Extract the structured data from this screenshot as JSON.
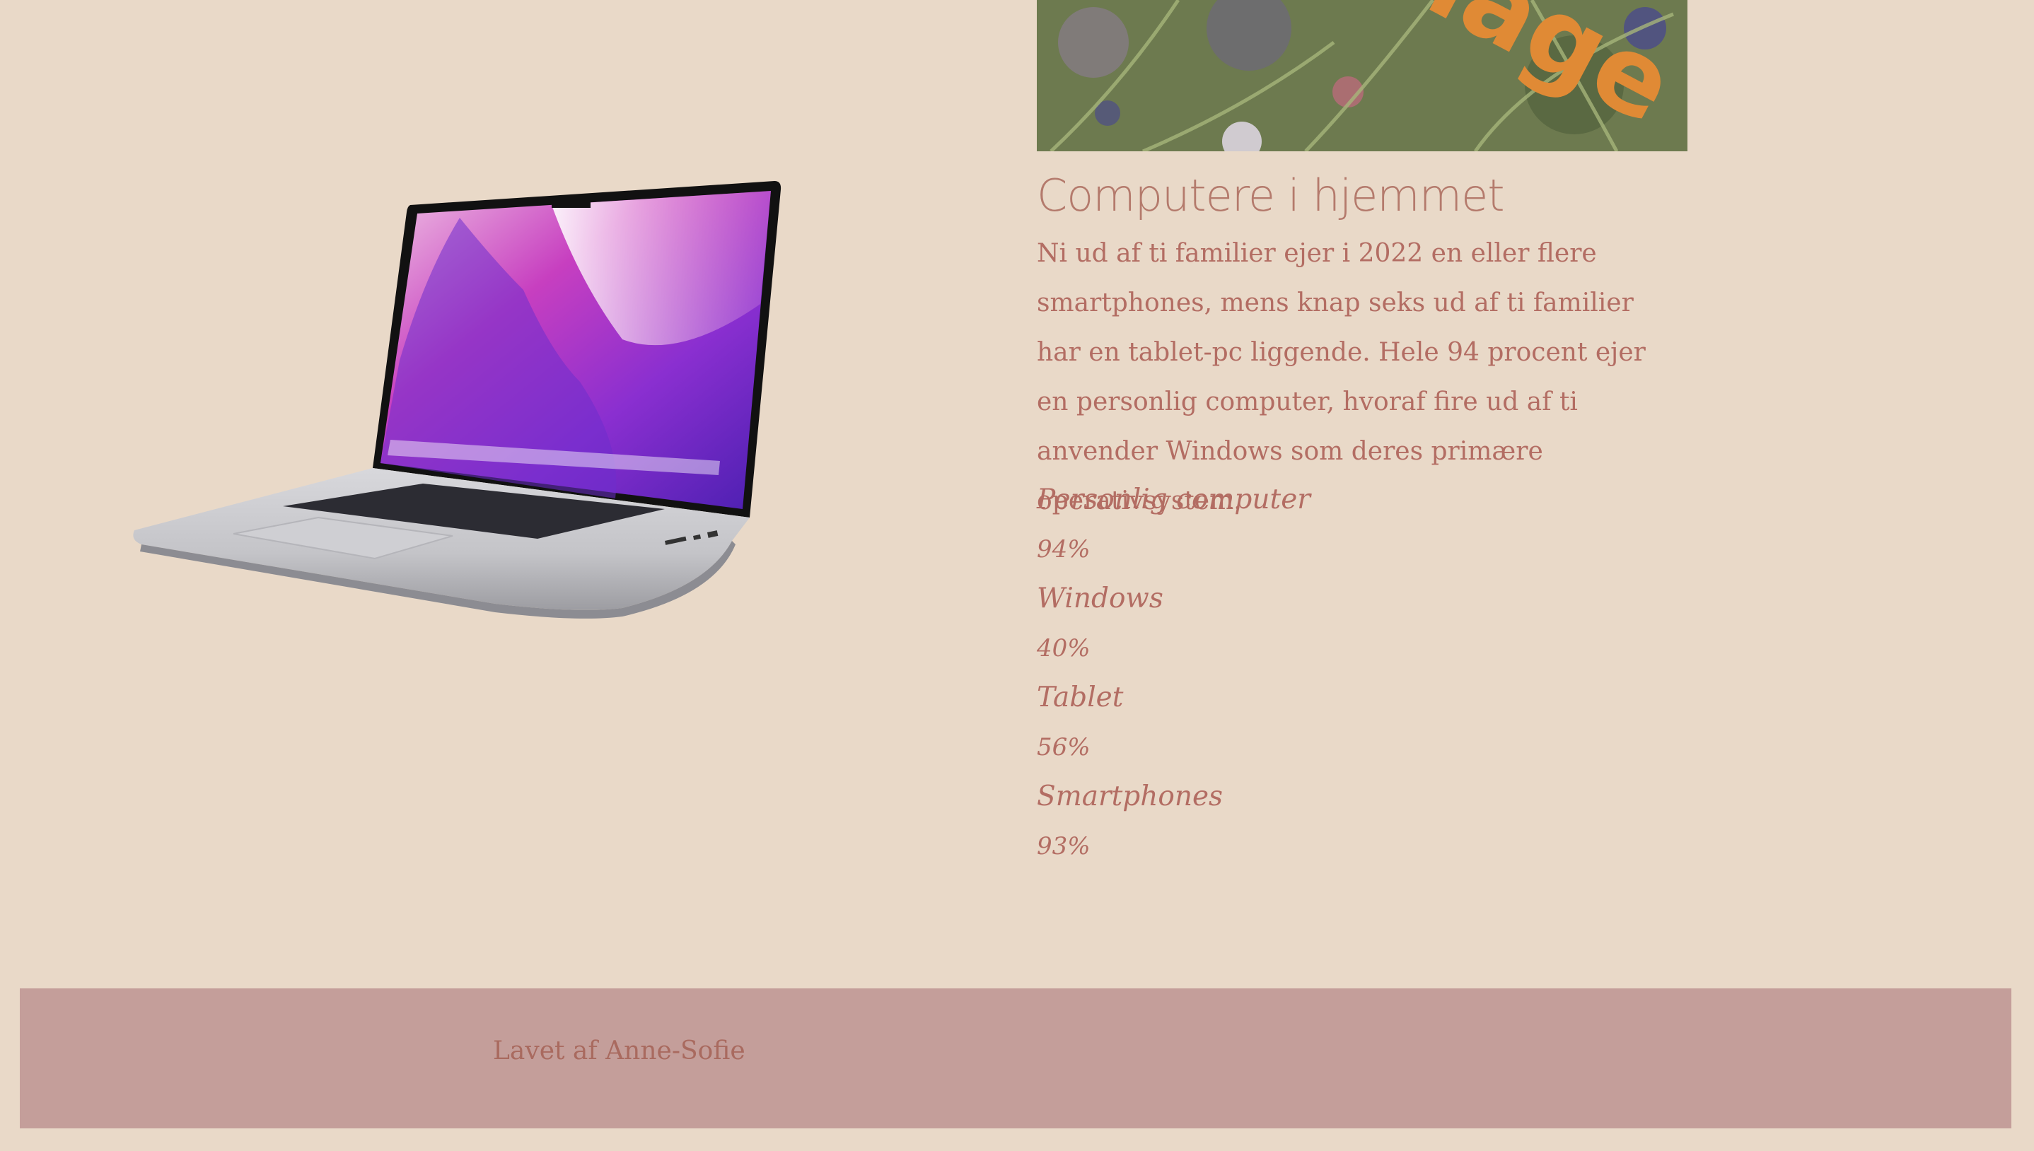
{
  "article": {
    "banner_text": "hage",
    "heading": "Computere i hjemmet",
    "intro": "Ni ud af ti familier ejer i 2022 en eller flere smartphones, mens knap seks ud af ti familier har en tablet-pc liggende. Hele 94 procent ejer en personlig computer, hvoraf fire ud af ti anvender Windows som deres primære operativsystem.",
    "stats": [
      {
        "label": "Personlig computer",
        "value": "94%"
      },
      {
        "label": "Windows",
        "value": "40%"
      },
      {
        "label": "Tablet",
        "value": "56%"
      },
      {
        "label": "Smartphones",
        "value": "93%"
      }
    ]
  },
  "footer": {
    "credit": "Lavet af Anne-Sofie"
  },
  "colors": {
    "background": "#e9d9c8",
    "text": "#b36d63",
    "footer": "#c49e9a",
    "banner_lettering": "#e08a35"
  }
}
